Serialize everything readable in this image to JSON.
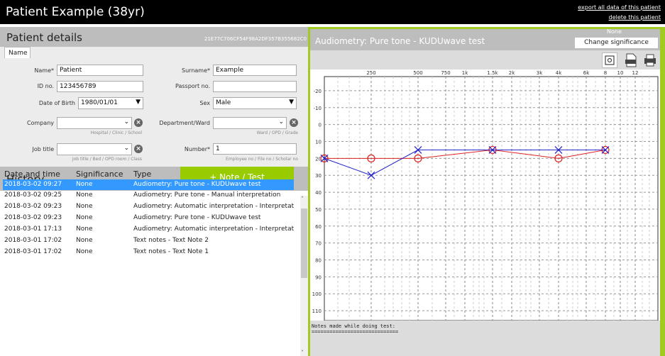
{
  "app": {
    "title": "Patient Example (38yr)",
    "links": {
      "export": "export all data of this patient",
      "delete": "delete this patient"
    }
  },
  "patient": {
    "section_title": "Patient details",
    "record_id": "21E77C706CF54F98A2DF357B355682C0",
    "tab": "Name",
    "name_label": "Name*",
    "name_value": "Patient",
    "surname_label": "Surname*",
    "surname_value": "Example",
    "id_label": "ID no.",
    "id_value": "123456789",
    "passport_label": "Passport no.",
    "passport_value": "",
    "dob_label": "Date of Birth",
    "dob_value": "1980/01/01",
    "sex_label": "Sex",
    "sex_value": "Male",
    "company_label": "Company",
    "company_hint": "Hospital / Clinic / School",
    "dept_label": "Department/Ward",
    "dept_hint": "Ward / OPD / Grade",
    "job_label": "Job title",
    "job_hint": "Job title / Bed / OPD room / Class",
    "number_label": "Number*",
    "number_value": "1",
    "number_hint": "Employee no / File no / Scholar no"
  },
  "history": {
    "title": "History",
    "add_button": "+ Note / Test",
    "columns": [
      "Date and time",
      "Significance",
      "Type"
    ],
    "rows": [
      {
        "date": "2018-03-02 09:27",
        "sig": "None",
        "type": "Audiometry: Pure tone - KUDUwave test"
      },
      {
        "date": "2018-03-02 09:25",
        "sig": "None",
        "type": "Audiometry: Pure tone - Manual interpretation"
      },
      {
        "date": "2018-03-02 09:23",
        "sig": "None",
        "type": "Audiometry: Automatic interpretation - Interpretation"
      },
      {
        "date": "2018-03-02 09:23",
        "sig": "None",
        "type": "Audiometry: Pure tone - KUDUwave test"
      },
      {
        "date": "2018-03-01 17:13",
        "sig": "None",
        "type": "Audiometry: Automatic interpretation - Interpretation"
      },
      {
        "date": "2018-03-01 17:02",
        "sig": "None",
        "type": "Text notes - Text Note 2"
      },
      {
        "date": "2018-03-01 17:02",
        "sig": "None",
        "type": "Text notes - Text Note 1"
      }
    ]
  },
  "detail": {
    "title": "Audiometry: Pure tone - KUDUwave test",
    "significance": "None",
    "change_button": "Change significance",
    "notes": "Notes made while doing test:",
    "notes_rule": "=============================",
    "colors": {
      "right_ear": "#dd2222",
      "left_ear": "#2222cc",
      "accent": "#99cc00"
    }
  },
  "chart_data": {
    "type": "line",
    "x_ticks": [
      "250",
      "500",
      "750",
      "1k",
      "1.5k",
      "2k",
      "3k",
      "4k",
      "6k",
      "8",
      "10",
      "12"
    ],
    "y_ticks": [
      "-20",
      "-10",
      "0",
      "10",
      "20",
      "30",
      "40",
      "50",
      "60",
      "70",
      "80",
      "90",
      "100",
      "110"
    ],
    "ylim": [
      -25,
      115
    ],
    "y_inverted": true,
    "grid": true,
    "series": [
      {
        "marker": "circle",
        "color": "#dd2222",
        "x": [
          "125",
          "250",
          "500",
          "1.5k",
          "4k",
          "8"
        ],
        "values": [
          20,
          20,
          20,
          15,
          20,
          15
        ]
      },
      {
        "marker": "x",
        "color": "#2222cc",
        "x": [
          "125",
          "250",
          "500",
          "1.5k",
          "4k",
          "8"
        ],
        "values": [
          20,
          30,
          15,
          15,
          15,
          15
        ]
      }
    ]
  }
}
